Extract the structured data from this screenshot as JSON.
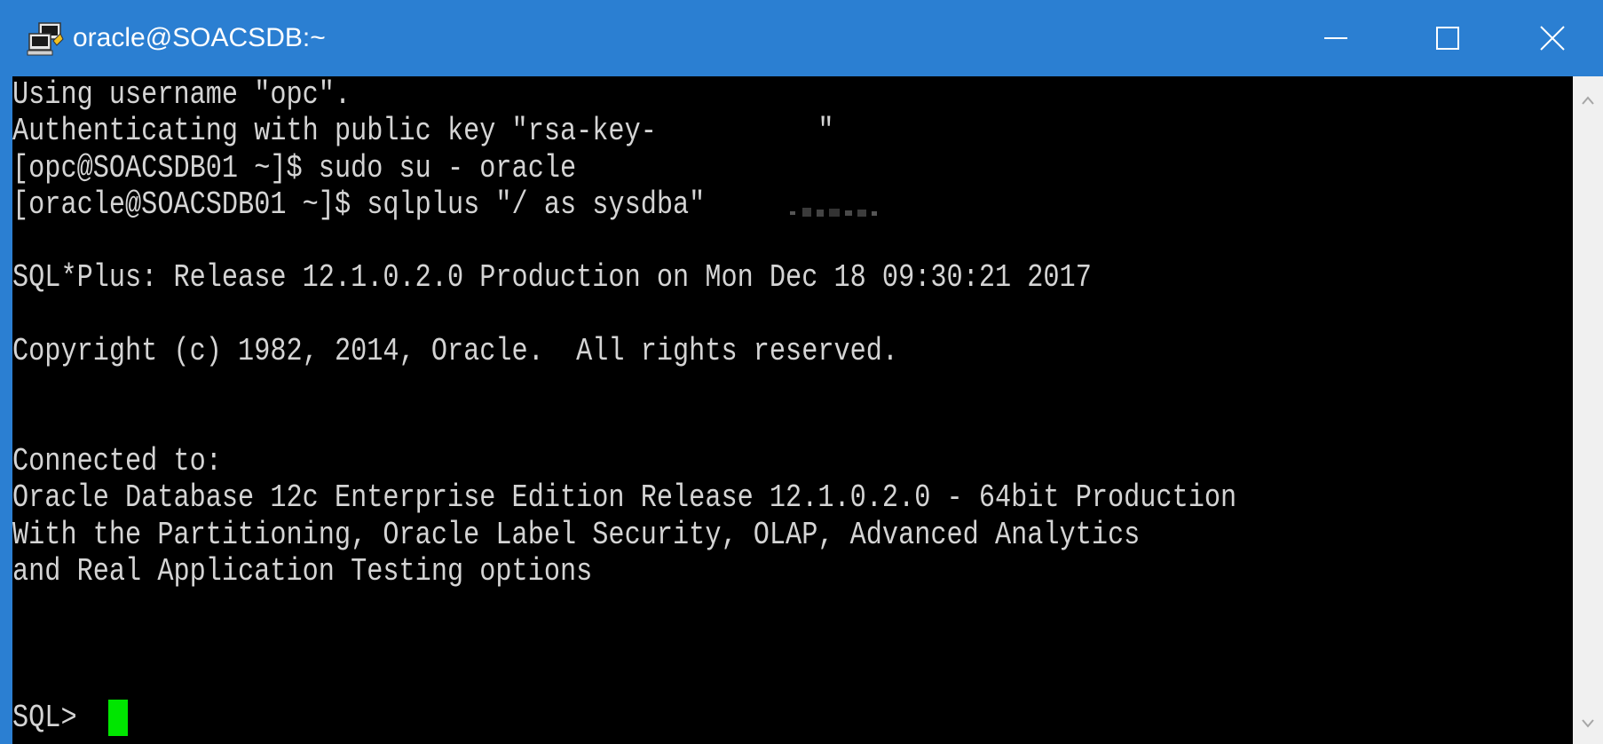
{
  "window": {
    "title": "oracle@SOACSDB:~",
    "accent_color": "#2b7fd2",
    "icon": "putty-terminal-icon",
    "controls": {
      "minimize_icon": "minimize-icon",
      "maximize_icon": "maximize-icon",
      "close_icon": "close-icon"
    }
  },
  "terminal": {
    "background": "#000000",
    "text_color": "#d4d4d4",
    "cursor_color": "#00e600",
    "lines": [
      "Using username \"opc\".",
      "Authenticating with public key \"rsa-key-          \"",
      "[opc@SOACSDB01 ~]$ sudo su - oracle",
      "[oracle@SOACSDB01 ~]$ sqlplus \"/ as sysdba\"",
      "",
      "SQL*Plus: Release 12.1.0.2.0 Production on Mon Dec 18 09:30:21 2017",
      "",
      "Copyright (c) 1982, 2014, Oracle.  All rights reserved.",
      "",
      "",
      "Connected to:",
      "Oracle Database 12c Enterprise Edition Release 12.1.0.2.0 - 64bit Production",
      "With the Partitioning, Oracle Label Security, OLAP, Advanced Analytics",
      "and Real Application Testing options",
      ""
    ],
    "prompt": "SQL> "
  },
  "scrollbar": {
    "up_icon": "scroll-up-arrow-icon",
    "down_icon": "scroll-down-arrow-icon"
  }
}
